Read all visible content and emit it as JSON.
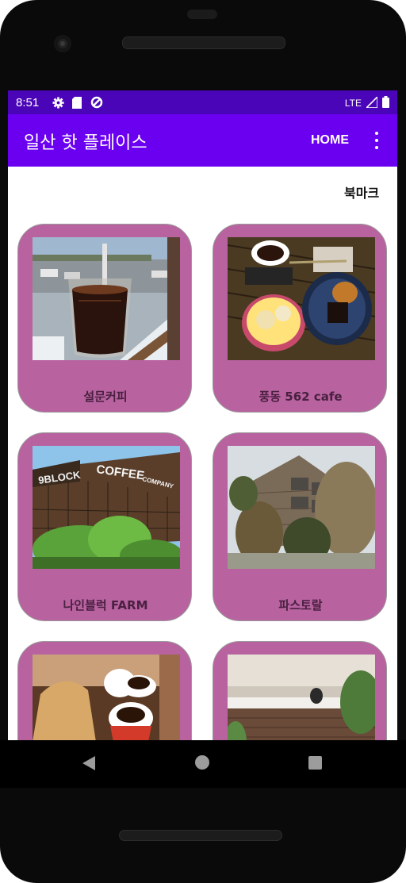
{
  "status_bar": {
    "time": "8:51",
    "network": "LTE",
    "icons": [
      "gear-icon",
      "sd-card-icon",
      "data-saver-icon",
      "signal-icon",
      "battery-icon"
    ]
  },
  "app_bar": {
    "title": "일산 핫 플레이스",
    "home_label": "HOME",
    "menu_icon": "more-vert-icon",
    "color": "#6b00f0"
  },
  "bookmark_label": "북마크",
  "places": [
    {
      "name": "설문커피"
    },
    {
      "name": "풍동 562 cafe"
    },
    {
      "name": "나인블럭 FARM"
    },
    {
      "name": "파스토랄"
    },
    {
      "name": ""
    },
    {
      "name": ""
    }
  ],
  "photo_text": {
    "block_sign": "9BLOCK",
    "coffee_sign": "COFFEE",
    "company_sign": "COMPANY"
  },
  "card_color": "#b863a0",
  "nav_bar": {
    "icons": [
      "back-icon",
      "home-icon",
      "recent-apps-icon"
    ]
  }
}
